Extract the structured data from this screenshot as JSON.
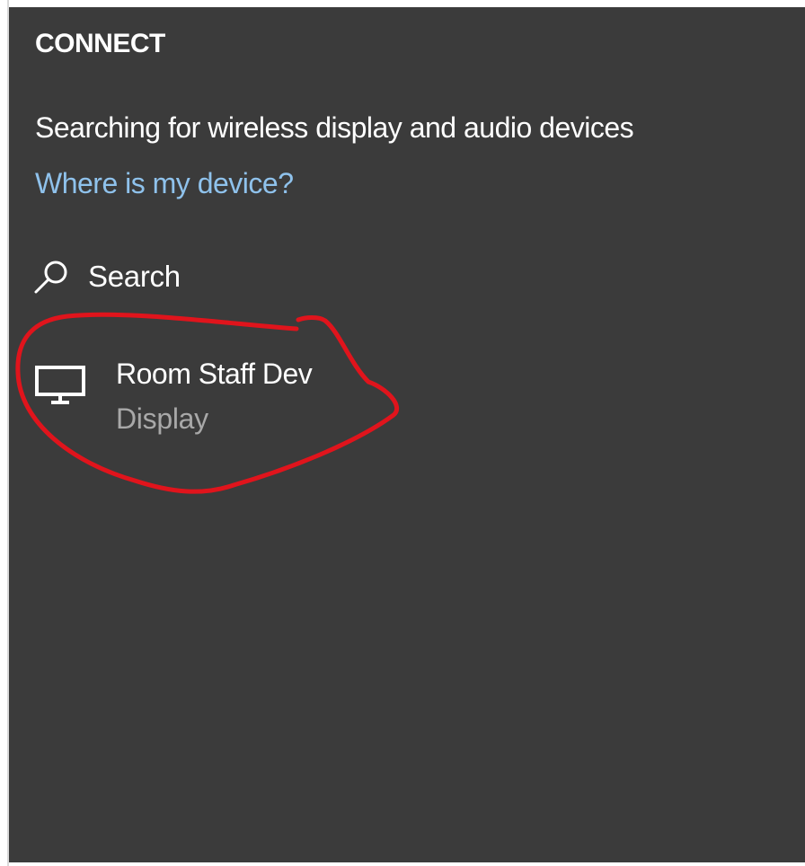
{
  "panel": {
    "title": "CONNECT",
    "status_text": "Searching for wireless display and audio devices",
    "help_link": "Where is my device?"
  },
  "search": {
    "label": "Search",
    "icon": "search-icon"
  },
  "devices": [
    {
      "name": "Room Staff Dev",
      "type": "Display",
      "icon": "monitor-icon"
    }
  ],
  "colors": {
    "panel_background": "#3b3b3b",
    "text_primary": "#ffffff",
    "text_secondary": "#a8a8a8",
    "link": "#8fc2ec",
    "annotation": "#e0141c"
  }
}
